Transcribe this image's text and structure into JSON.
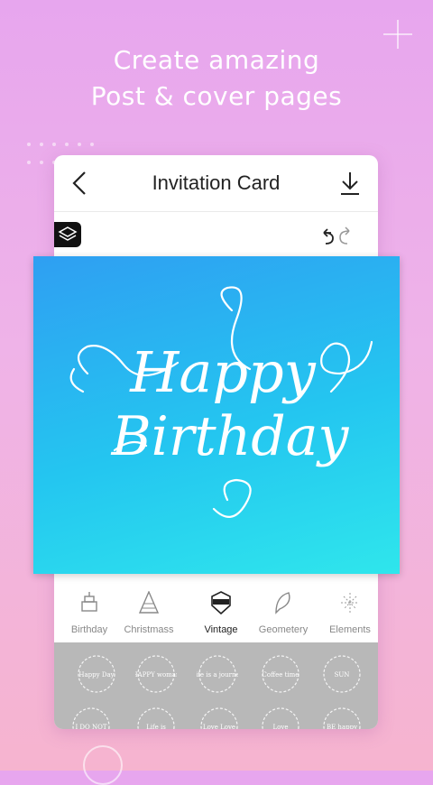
{
  "headline": {
    "line1": "Create amazing",
    "line2": "Post & cover pages"
  },
  "editor": {
    "title": "Invitation Card",
    "back_icon": "chevron-left-icon",
    "download_icon": "download-icon",
    "layers_icon": "layers-icon",
    "undo_icon": "undo-icon",
    "redo_icon": "redo-icon"
  },
  "card": {
    "line1": "Happy",
    "line2": "Birthday",
    "gradient": [
      "#2f9ff2",
      "#2fe6ec"
    ]
  },
  "categories": [
    {
      "label": "Birthday",
      "icon": "cake-icon",
      "active": false
    },
    {
      "label": "Christmass",
      "icon": "tree-icon",
      "active": false
    },
    {
      "label": "Vintage",
      "icon": "badge-icon",
      "active": true
    },
    {
      "label": "Geometery",
      "icon": "feather-icon",
      "active": false
    },
    {
      "label": "Elements",
      "icon": "sparkle-icon",
      "active": false
    }
  ],
  "stickers": [
    {
      "text": "Happy Day"
    },
    {
      "text": "HAPPY woman"
    },
    {
      "text": "Life is a journey"
    },
    {
      "text": "Coffee time"
    },
    {
      "text": "SUN"
    },
    {
      "text": "I DO NOT"
    },
    {
      "text": "Life is"
    },
    {
      "text": "Love Love"
    },
    {
      "text": "Love"
    },
    {
      "text": "BE happy"
    }
  ],
  "colors": {
    "accent_bg_top": "#e7a6ee",
    "accent_bg_bottom": "#f6b4cf",
    "sticker_panel": "#b8b8b8"
  }
}
